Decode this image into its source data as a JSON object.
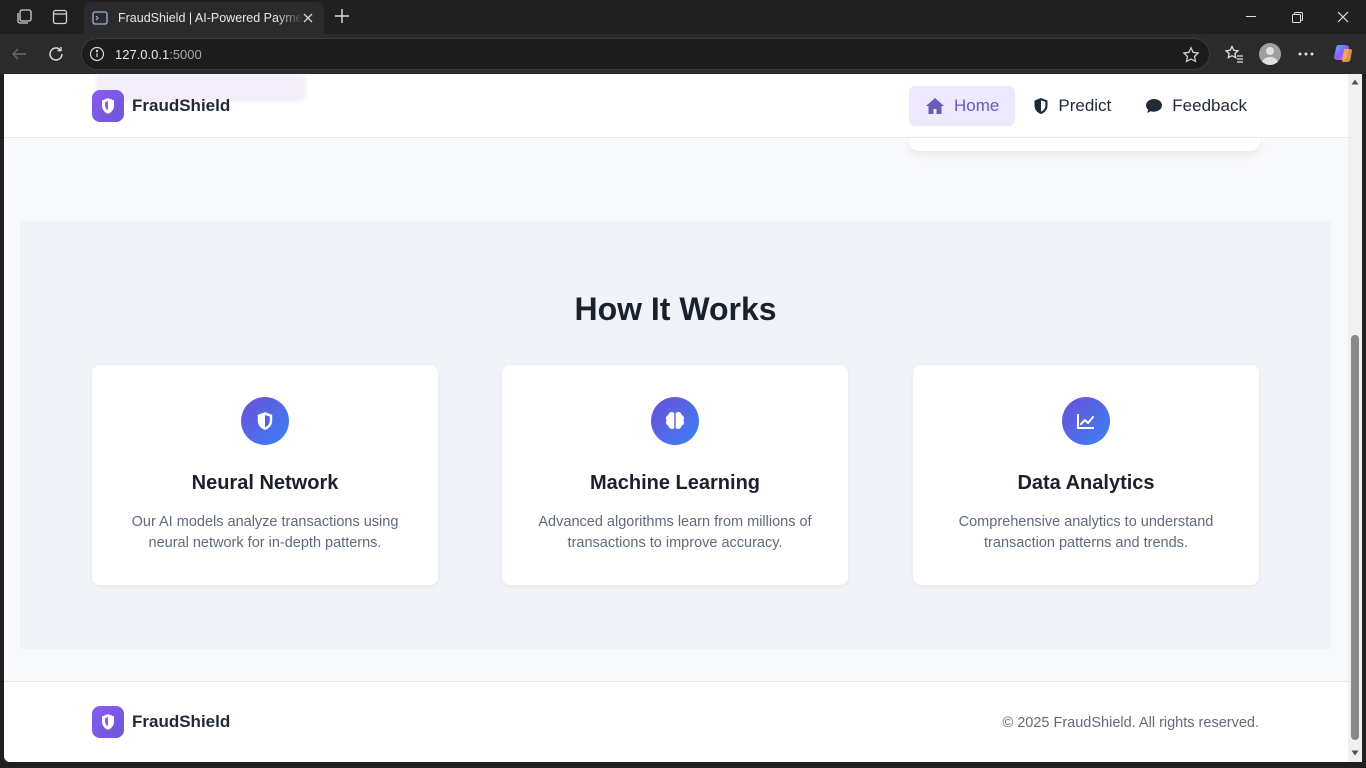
{
  "browser": {
    "tab_title": "FraudShield | AI-Powered Payment Fraud Detection",
    "url_host": "127.0.0.1",
    "url_port": ":5000"
  },
  "header": {
    "brand": "FraudShield",
    "nav": [
      {
        "label": "Home",
        "icon": "home-icon",
        "active": true
      },
      {
        "label": "Predict",
        "icon": "shield-icon",
        "active": false
      },
      {
        "label": "Feedback",
        "icon": "chat-icon",
        "active": false
      }
    ]
  },
  "how_it_works": {
    "title": "How It Works",
    "cards": [
      {
        "icon": "shield-icon",
        "title": "Neural Network",
        "description": "Our AI models analyze transactions using neural network for in-depth patterns."
      },
      {
        "icon": "brain-icon",
        "title": "Machine Learning",
        "description": "Advanced algorithms learn from millions of transactions to improve accuracy."
      },
      {
        "icon": "chart-line-icon",
        "title": "Data Analytics",
        "description": "Comprehensive analytics to understand transaction patterns and trends."
      }
    ]
  },
  "footer": {
    "brand": "FraudShield",
    "copyright": "© 2025 FraudShield. All rights reserved."
  },
  "colors": {
    "accent": "#6d56d6",
    "icon_gradient_start": "#6b4fd8",
    "icon_gradient_end": "#3b82f6",
    "nav_active_bg": "#ede8fb"
  }
}
